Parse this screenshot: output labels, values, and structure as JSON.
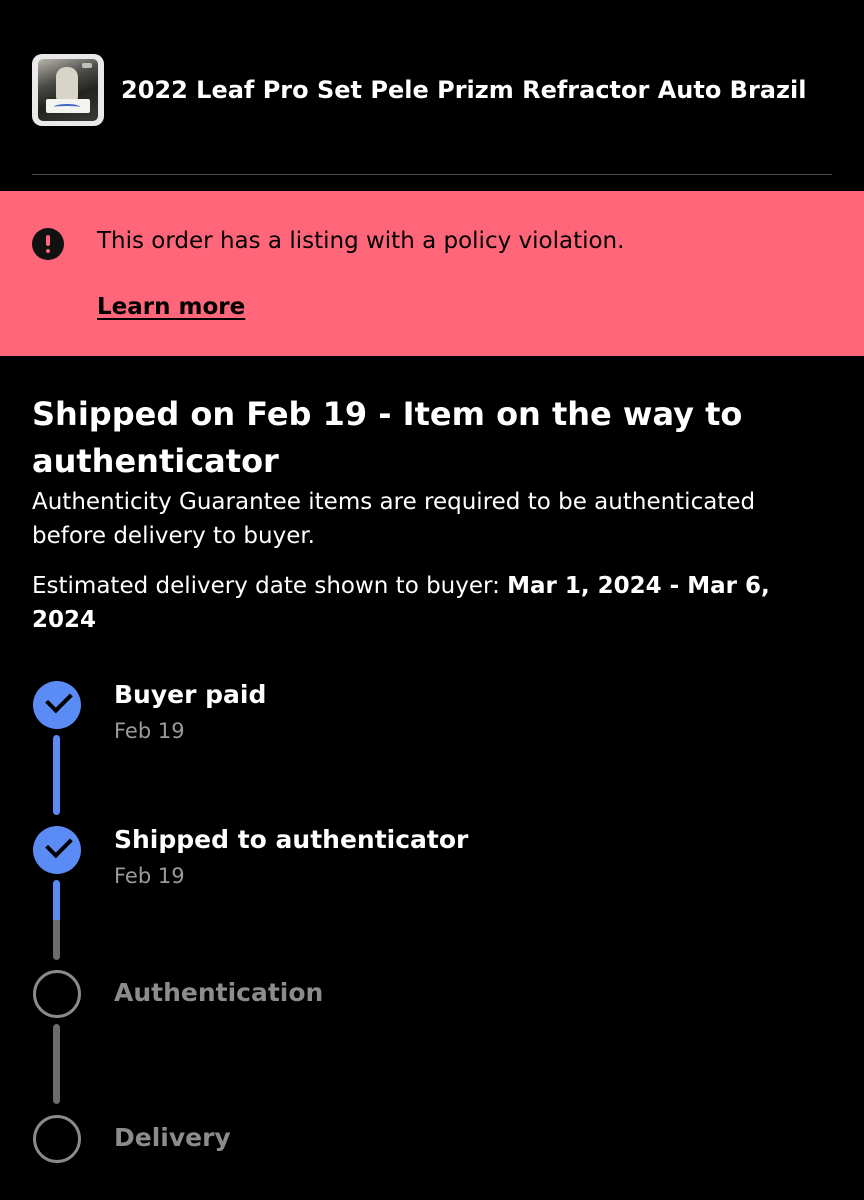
{
  "item": {
    "title": "2022 Leaf Pro Set Pele Prizm Refractor Auto Brazil",
    "thumbnail_icon": "trading-card-thumbnail"
  },
  "alert": {
    "icon": "exclamation-circle-icon",
    "message": "This order has a listing with a policy violation.",
    "link_label": "Learn more",
    "background_color": "#ff6679"
  },
  "status": {
    "heading": "Shipped on Feb 19 - Item on the way to authenticator",
    "description": "Authenticity Guarantee items are required to be authenticated before delivery to buyer.",
    "estimate_label": "Estimated delivery date shown to buyer: ",
    "estimate_value": "Mar 1, 2024 - Mar 6, 2024"
  },
  "timeline": {
    "accent_color": "#5b8cf5",
    "inactive_color": "#8a8a8a",
    "steps": [
      {
        "label": "Buyer paid",
        "date": "Feb 19",
        "completed": true
      },
      {
        "label": "Shipped to authenticator",
        "date": "Feb 19",
        "completed": true
      },
      {
        "label": "Authentication",
        "date": "",
        "completed": false
      },
      {
        "label": "Delivery",
        "date": "",
        "completed": false
      }
    ]
  }
}
